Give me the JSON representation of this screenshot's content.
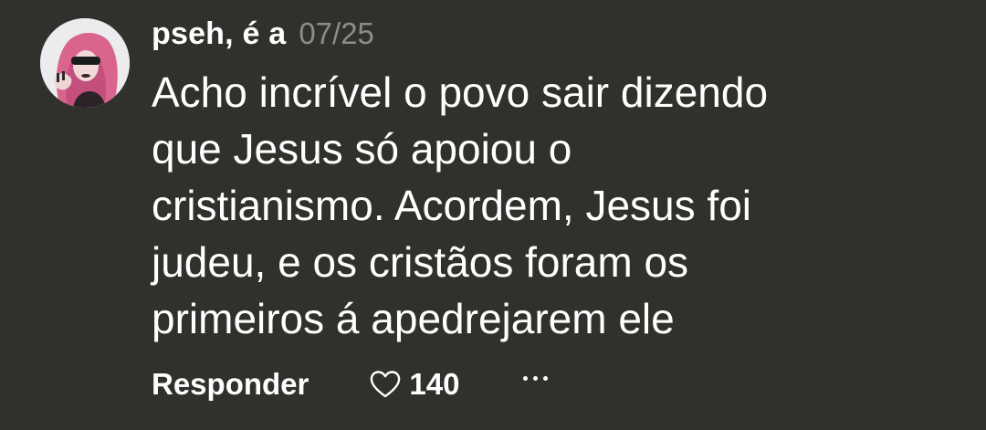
{
  "comment": {
    "author": "pseh, é a",
    "date": "07/25",
    "text": "Acho incrível o povo sair dizendo\nque Jesus só apoiou o\ncristianismo. Acordem, Jesus foi\njudeu, e os cristãos foram os\nprimeiros á apedrejarem ele",
    "avatar_icon": "profile-photo",
    "actions": {
      "reply_label": "Responder",
      "like_icon": "heart-outline-icon",
      "like_count": "140",
      "more_icon": "more-horizontal-icon"
    }
  },
  "colors": {
    "background": "#30302c",
    "text": "#ffffff",
    "date": "#8d8d88"
  }
}
